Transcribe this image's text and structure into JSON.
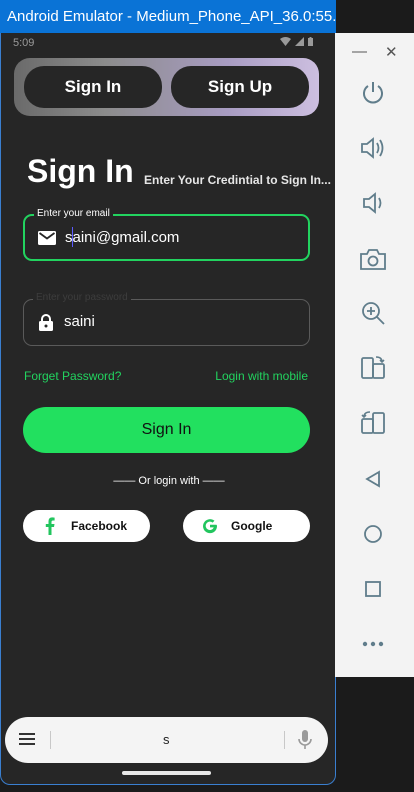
{
  "window": {
    "title": "Android Emulator - Medium_Phone_API_36.0:55..."
  },
  "status_bar": {
    "time": "5:09"
  },
  "auth_tabs": {
    "sign_in": "Sign In",
    "sign_up": "Sign Up"
  },
  "page": {
    "heading": "Sign In",
    "subheading": "Enter Your Credintial to Sign In..."
  },
  "email_field": {
    "label": "Enter your email",
    "value": "saini@gmail.com"
  },
  "password_field": {
    "label": "Enter your password",
    "value": "saini"
  },
  "links": {
    "forgot_password": "Forget Password?",
    "login_mobile": "Login with mobile"
  },
  "sign_in_button": {
    "label": "Sign In"
  },
  "divider": {
    "label": "—— Or login with ——"
  },
  "social": {
    "facebook": "Facebook",
    "google": "Google"
  },
  "keyboard": {
    "suggestion": "s"
  },
  "colors": {
    "accent": "#22E05F",
    "background": "#262626",
    "title_bar": "#0A73D6"
  }
}
